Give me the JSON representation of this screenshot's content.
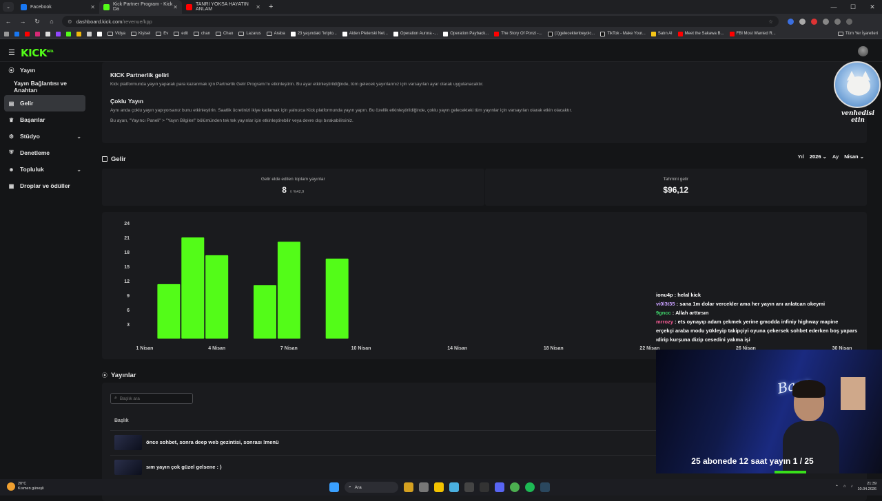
{
  "browser": {
    "tabs": [
      {
        "label": "Facebook",
        "color": "#1877f2"
      },
      {
        "label": "Kick Partner Program - Kick Da",
        "color": "#53fc18"
      },
      {
        "label": "TANRI YOKSA HAYATIN ANLAM",
        "color": "#ff0000"
      }
    ],
    "url_host": "dashboard.kick.com",
    "url_path": "/revenue/kpp",
    "bookmarks": [
      "Vidya",
      "Kişisel",
      "Ev",
      "edit",
      "chan",
      "Chao",
      "Lazarus",
      "Araba",
      "23 yaşındaki \"kripto...",
      "Aiden Pleterski Net...",
      "Operation Aurora -...",
      "Operation Payback...",
      "The Story Of Ponzi -...",
      "(1)gelecektenbeyoic...",
      "TikTok - Make Your...",
      "Satın Al",
      "Meet the Sakawa B...",
      "FBI Most Wanted R..."
    ],
    "bookmarks_right": "Tüm Yer İşaretleri"
  },
  "app": {
    "logo": "KICK",
    "logo_badge": "BETA"
  },
  "sidebar": {
    "items": [
      {
        "label": "Yayın",
        "icon": "broadcast-icon"
      },
      {
        "label": "Yayın Bağlantısı ve Anahtarı",
        "icon": ""
      },
      {
        "label": "Gelir",
        "icon": "chart-icon"
      },
      {
        "label": "Başarılar",
        "icon": "trophy-icon"
      },
      {
        "label": "Stüdyo",
        "icon": "studio-icon"
      },
      {
        "label": "Denetleme",
        "icon": "shield-icon"
      },
      {
        "label": "Topluluk",
        "icon": "users-icon"
      },
      {
        "label": "Droplar ve ödüller",
        "icon": "gift-icon"
      }
    ]
  },
  "info": {
    "partner_title": "KICK Partnerlik geliri",
    "partner_text": "Kick platformunda yayın yaparak para kazanmak için Partnerlik Gelir Programı'nı etkinleştirin. Bu ayar etkinleştirildiğinde, tüm gelecek yayınlarınız için varsayılan ayar olarak uygulanacaktır.",
    "multi_title": "Çoklu Yayın",
    "multi_text": "Aynı anda çoklu yayın yapıyorsanız bunu etkinleştirin. Saatlik ücretinizi ikiye katlamak için yalnızca Kick platformunda yayın yapın. Bu özellik etkinleştirildiğinde, çoklu yayın gelecekteki tüm yayınlar için varsayılan olarak etkin olacaktır.",
    "multi_note": "Bu ayarı, \"Yayıncı Paneli\" > \"Yayın Bilgileri\" bölümünden tek tek yayınlar için etkinleştirebilir veya devre dışı bırakabilirsiniz."
  },
  "revenue": {
    "title": "Gelir",
    "year_label": "Yıl",
    "year_value": "2026",
    "month_label": "Ay",
    "month_value": "Nisan",
    "total_streams_label": "Gelir elde edilen toplam yayınlar",
    "total_streams_value": "8",
    "total_streams_delta": "%42,9",
    "estimated_label": "Tahmini gelir",
    "estimated_value": "$96,12"
  },
  "chart_data": {
    "type": "bar",
    "title": "",
    "xlabel": "",
    "ylabel": "",
    "ylim": [
      0,
      24
    ],
    "yticks": [
      3,
      6,
      9,
      12,
      15,
      18,
      21,
      24
    ],
    "xticks": [
      "1 Nisan",
      "4 Nisan",
      "7 Nisan",
      "10 Nisan",
      "14 Nisan",
      "18 Nisan",
      "22 Nisan",
      "26 Nisan",
      "30 Nisan"
    ],
    "categories": [
      "2 Nisan",
      "3 Nisan",
      "4 Nisan",
      "6 Nisan",
      "7 Nisan",
      "9 Nisan"
    ],
    "values": [
      11.3,
      21,
      17.3,
      11.1,
      20.1,
      16.6
    ],
    "color": "#53fc18"
  },
  "streams": {
    "title": "Yayınlar",
    "search_placeholder": "Başlık ara",
    "column_title": "Başlık",
    "rows": [
      {
        "title": "önce sohbet, sonra deep web gezintisi, sonrası !menü"
      },
      {
        "title": "sım yayın çok güzel gelsene : )"
      }
    ]
  },
  "overlay": {
    "avatar_caption": "venhedisi etin",
    "chat": [
      {
        "user": "",
        "text": "ionu4p : helal kick",
        "color": "#ffffff"
      },
      {
        "user": "vi0l3t35",
        "text": " : sana 1m dolar vercekler ama her yayın anı anlatcan okeymi",
        "color": "#c9a0ff"
      },
      {
        "user": "9gncc",
        "text": " : Allah arttırsın",
        "color": "#3fd56b"
      },
      {
        "user": "mrrozy",
        "text": " : ets oynayıp adam çekmek yerine gmodda infiniy highway mapine",
        "color": "#ff5f9a"
      },
      {
        "user": "",
        "text": "erçekçi araba modu yükleyip takipçiyi oyuna çekersek sohbet ederken boş yapars",
        "color": "#ffffff"
      },
      {
        "user": "",
        "text": "ıdirip kurşuna dizip cesedini yakma işi",
        "color": "#ffffff"
      }
    ],
    "webcam_neon": "Başo",
    "webcam_title": "25 abonede 12 saat yayın 1 / 25"
  },
  "taskbar": {
    "temp": "20°C",
    "weather": "Kısmen güneşli",
    "search": "Ara",
    "time": "21:39",
    "date": "10.04.2026"
  }
}
